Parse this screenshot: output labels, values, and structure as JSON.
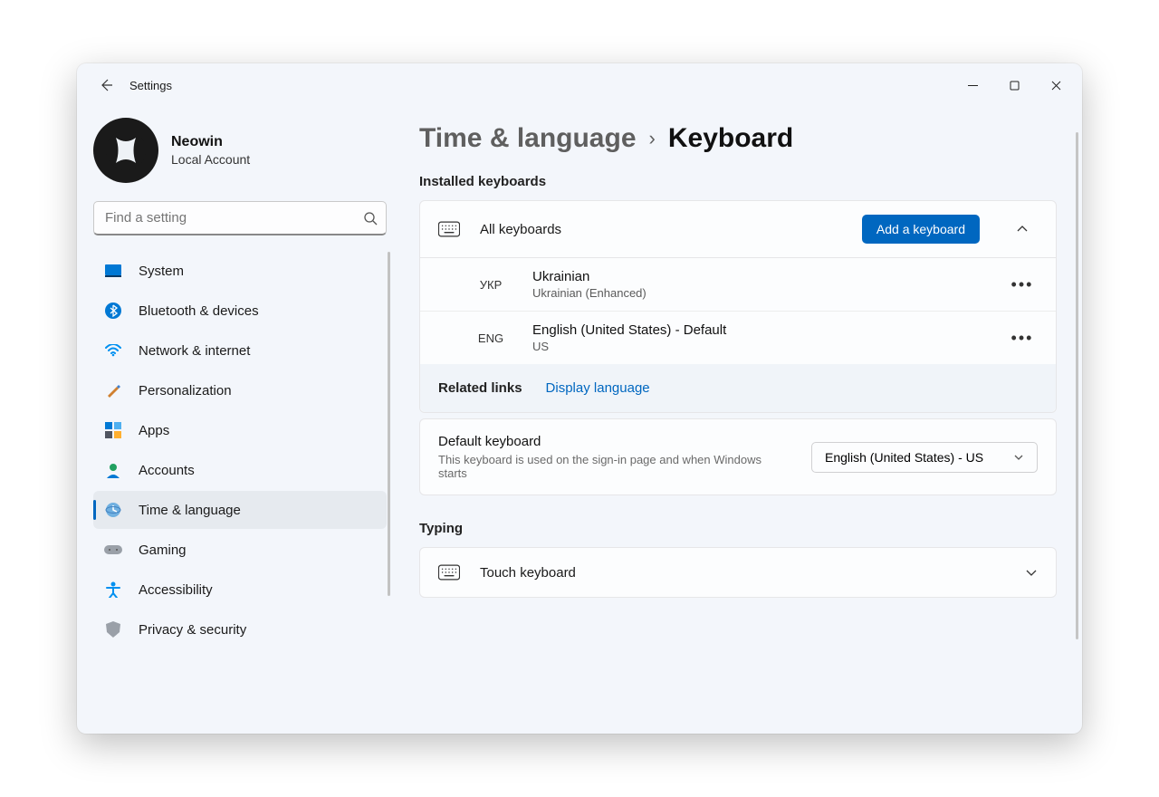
{
  "titlebar": {
    "title": "Settings"
  },
  "account": {
    "name": "Neowin",
    "subtitle": "Local Account"
  },
  "search": {
    "placeholder": "Find a setting"
  },
  "nav": {
    "items": [
      {
        "label": "System"
      },
      {
        "label": "Bluetooth & devices"
      },
      {
        "label": "Network & internet"
      },
      {
        "label": "Personalization"
      },
      {
        "label": "Apps"
      },
      {
        "label": "Accounts"
      },
      {
        "label": "Time & language"
      },
      {
        "label": "Gaming"
      },
      {
        "label": "Accessibility"
      },
      {
        "label": "Privacy & security"
      }
    ],
    "active_index": 6
  },
  "breadcrumb": {
    "parent": "Time & language",
    "current": "Keyboard"
  },
  "sections": {
    "installed_label": "Installed keyboards",
    "all_keyboards": "All keyboards",
    "add_button": "Add a keyboard",
    "keyboards": [
      {
        "tag": "УКР",
        "name": "Ukrainian",
        "sub": "Ukrainian (Enhanced)"
      },
      {
        "tag": "ENG",
        "name": "English (United States)   - Default",
        "sub": "US"
      }
    ],
    "related_label": "Related links",
    "related_link": "Display language",
    "default_title": "Default keyboard",
    "default_sub": "This keyboard is used on the sign-in page and when Windows starts",
    "default_selected": "English (United States) - US",
    "typing_label": "Typing",
    "touch_keyboard": "Touch keyboard"
  }
}
